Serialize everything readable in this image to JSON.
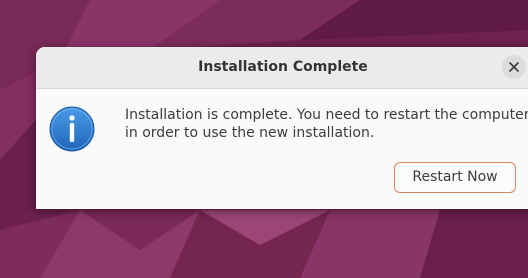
{
  "dialog": {
    "title": "Installation Complete",
    "message_line1": "Installation is complete. You need to restart the computer",
    "message_line2": "in order to use the new installation.",
    "restart_button_label": "Restart Now",
    "close_icon": "close-icon",
    "status_icon": "info-icon"
  },
  "colors": {
    "desktop_background": "#6e2150",
    "dialog_background": "#fafafa",
    "titlebar_background": "#ebebeb",
    "button_border_accent": "#d9835f",
    "info_icon_blue": "#2f7fd0"
  }
}
